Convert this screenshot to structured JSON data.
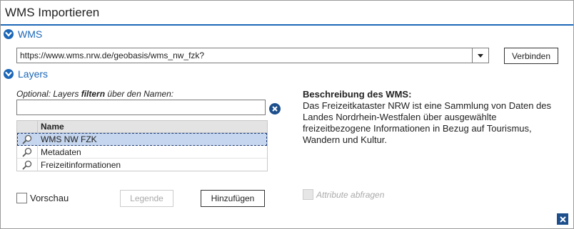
{
  "window": {
    "title": "WMS Importieren"
  },
  "wms": {
    "section_label": "WMS",
    "url_value": "https://www.wms.nrw.de/geobasis/wms_nw_fzk?",
    "connect_label": "Verbinden"
  },
  "layers": {
    "section_label": "Layers",
    "filter_hint_prefix": "Optional: Layers ",
    "filter_hint_bold": "filtern",
    "filter_hint_suffix": " über den Namen:",
    "filter_value": "",
    "column_name": "Name",
    "rows": [
      {
        "name": "WMS NW FZK",
        "selected": true
      },
      {
        "name": "Metadaten",
        "selected": false
      },
      {
        "name": "Freizeitinformationen",
        "selected": false
      }
    ]
  },
  "description": {
    "title": "Beschreibung des WMS:",
    "text": "Das Freizeitkataster NRW ist eine Sammlung von Daten des Landes Nordrhein-Westfalen über ausgewählte freizeitbezogene Informationen in Bezug auf Tourismus, Wandern und Kultur."
  },
  "footer": {
    "preview_label": "Vorschau",
    "legend_label": "Legende",
    "add_label": "Hinzufügen",
    "attributes_label": "Attribute abfragen"
  },
  "colors": {
    "accent": "#1c67b8",
    "selection": "#c5d6ee"
  },
  "icons": [
    "chevron-down-icon",
    "dropdown-arrow-icon",
    "clear-icon",
    "magnifier-icon",
    "close-icon"
  ]
}
